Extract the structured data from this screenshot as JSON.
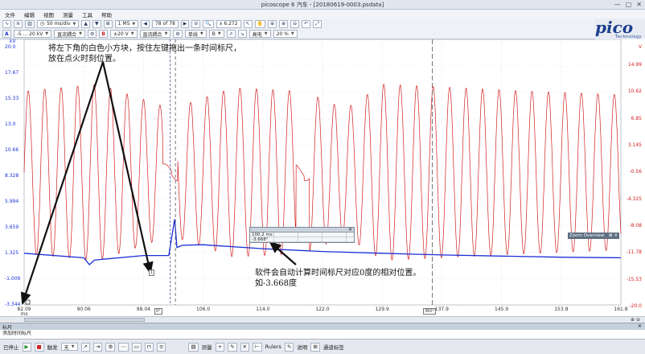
{
  "window": {
    "title": "picoscope 6 汽车 - [20180619-0003.psdata]",
    "buttons": [
      "—",
      "▢",
      "✕"
    ]
  },
  "menu": [
    "文件",
    "编辑",
    "视图",
    "测量",
    "工具",
    "帮助"
  ],
  "toolbar1": {
    "timebase": "50 ms/div",
    "samples": "1 MS",
    "buffer": "78 of 78",
    "zoom": "x 6.272"
  },
  "toolbar2": {
    "channel_a_label": "A",
    "channel_a_range": "-5 ... 20 kV",
    "channel_a_coupling": "直流耦合",
    "channel_b_label": "B",
    "channel_b_range": "±20 V",
    "channel_b_coupling": "直流耦合",
    "trigger_mode": "单线",
    "trigger_channel": "B",
    "trigger_edge": "高电",
    "trigger_level": "20 %"
  },
  "logo": {
    "text": "pico",
    "sub": "Technology"
  },
  "axes": {
    "left_unit": "kV",
    "left_ticks": [
      "20.0",
      "17.67",
      "15.33",
      "13.0",
      "10.66",
      "8.328",
      "5.994",
      "3.659",
      "1.325",
      "-1.009",
      "-3.344"
    ],
    "right_unit": "V",
    "right_ticks": [
      "14.99",
      "10.62",
      "6.85",
      "3.145",
      "-0.56",
      "-4.325",
      "-8.08",
      "-11.78",
      "-15.53",
      "-20.0"
    ],
    "x_ticks": [
      "82.09",
      "90.06",
      "98.04",
      "106.0",
      "114.0",
      "122.0",
      "129.9",
      "137.9",
      "145.9",
      "153.8",
      "161.8"
    ],
    "x_unit": "ms"
  },
  "annotations": {
    "top_line1": "将左下角的白色小方块，按住左键拖出一条时间标尺，",
    "top_line2": "放在点火时刻位置。",
    "bottom_line1": "软件会自动计算时间标尺对应0度的相对位置。",
    "bottom_line2": "如-3.668度"
  },
  "ruler_table": {
    "row1": "100.2 ms",
    "row2": "-3.668°"
  },
  "markers": {
    "left": "1",
    "mid": "0°",
    "right": "360°"
  },
  "zoom_overview": {
    "label": "Zoom Overview"
  },
  "ruler_panel": {
    "title": "标尺",
    "subtitle": "添加时间标尺"
  },
  "statusbar": {
    "stop_label": "已停止",
    "trigger_label": "触发",
    "trigger_value": "无",
    "measure_label": "测量",
    "rulers_label": "Rulers",
    "notes_label": "说明",
    "channel_label": "通道标签"
  },
  "colors": {
    "channel_a": "#1a2fd6",
    "channel_b": "#d21f1f",
    "background": "#ffffff"
  },
  "chart_data": {
    "type": "line",
    "title": "",
    "xlabel": "ms",
    "ylabel": "kV",
    "xlim": [
      82.09,
      161.8
    ],
    "ylim": [
      -3.344,
      20.0
    ],
    "grid": true,
    "series": [
      {
        "name": "A",
        "axis": "left",
        "color": "#1a2fd6",
        "x": [
          82.09,
          90.06,
          90.8,
          91.5,
          98.04,
          101.4,
          101.8,
          102.2,
          102.5,
          103.2,
          106.0,
          114.0,
          122.0,
          129.9,
          137.9,
          145.9,
          153.8,
          161.8
        ],
        "y": [
          1.2,
          0.8,
          0.2,
          0.6,
          1.0,
          1.0,
          2.6,
          4.2,
          1.7,
          1.9,
          1.95,
          1.6,
          1.35,
          1.2,
          1.05,
          0.95,
          0.85,
          0.8
        ]
      },
      {
        "name": "B",
        "axis": "right",
        "color": "#d21f1f",
        "description_period_ms": 2.2,
        "x": [
          82.09,
          92.0,
          101.8,
          110.0,
          119.5,
          125.0,
          130.0,
          140.0,
          150.0,
          161.8
        ],
        "y_amplitude": [
          11.5,
          12.5,
          9.0,
          12.0,
          11.5,
          9.0,
          12.5,
          12.0,
          11.5,
          11.0
        ]
      }
    ]
  }
}
